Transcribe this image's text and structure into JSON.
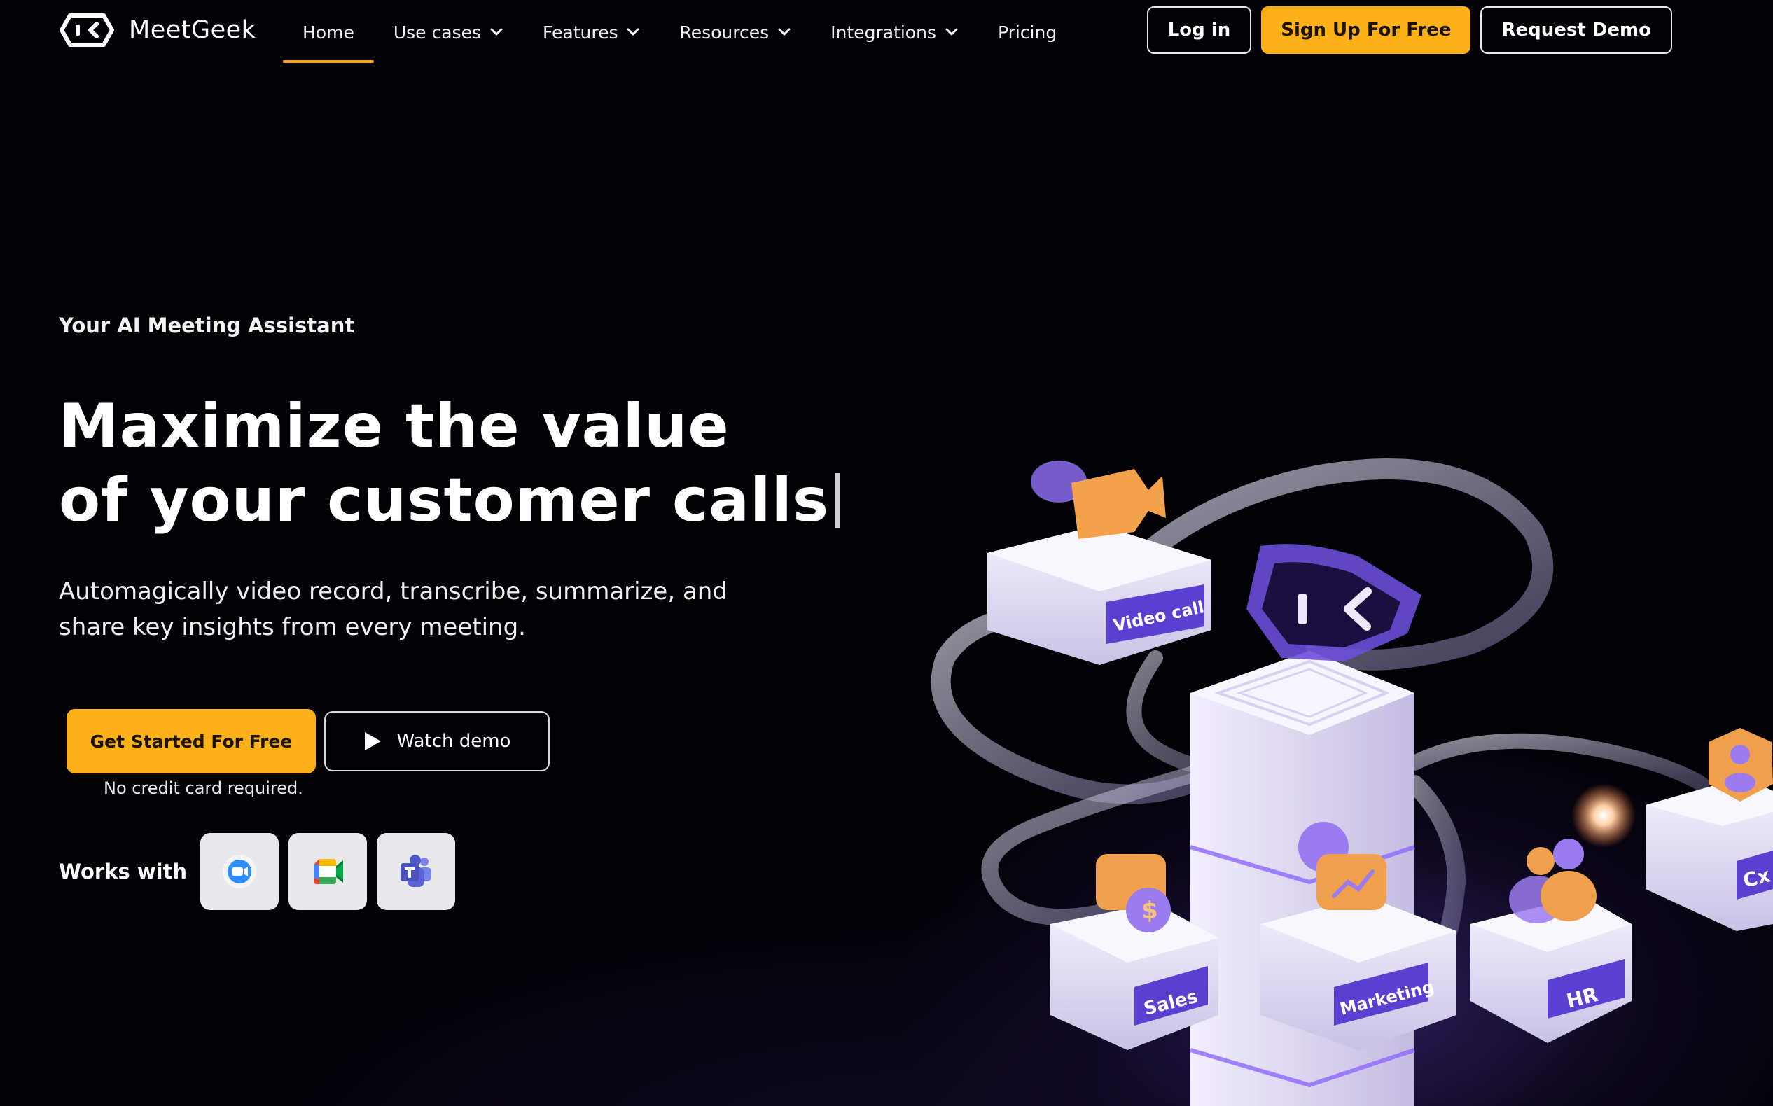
{
  "brand": {
    "name": "MeetGeek"
  },
  "nav": {
    "items": [
      {
        "label": "Home",
        "active": true,
        "dropdown": false
      },
      {
        "label": "Use cases",
        "active": false,
        "dropdown": true
      },
      {
        "label": "Features",
        "active": false,
        "dropdown": true
      },
      {
        "label": "Resources",
        "active": false,
        "dropdown": true
      },
      {
        "label": "Integrations",
        "active": false,
        "dropdown": true
      },
      {
        "label": "Pricing",
        "active": false,
        "dropdown": false
      }
    ],
    "login_label": "Log in",
    "signup_label": "Sign Up For Free",
    "demo_label": "Request Demo"
  },
  "hero": {
    "eyebrow": "Your AI Meeting Assistant",
    "headline_line1": "Maximize the value",
    "headline_line2": "of your customer calls",
    "subtext": "Automagically video record, transcribe, summarize, and share key insights from every meeting.",
    "cta_primary": "Get Started For Free",
    "cta_secondary": "Watch demo",
    "note": "No credit card required.",
    "works_with_label": "Works with",
    "apps": [
      "zoom-icon",
      "google-meet-icon",
      "microsoft-teams-icon"
    ]
  },
  "illustration": {
    "tags": [
      "Video call",
      "Sales",
      "Marketing",
      "HR",
      "Cx"
    ]
  },
  "colors": {
    "accent": "#fbb117",
    "background": "#020105",
    "purple": "#6b4de6"
  }
}
